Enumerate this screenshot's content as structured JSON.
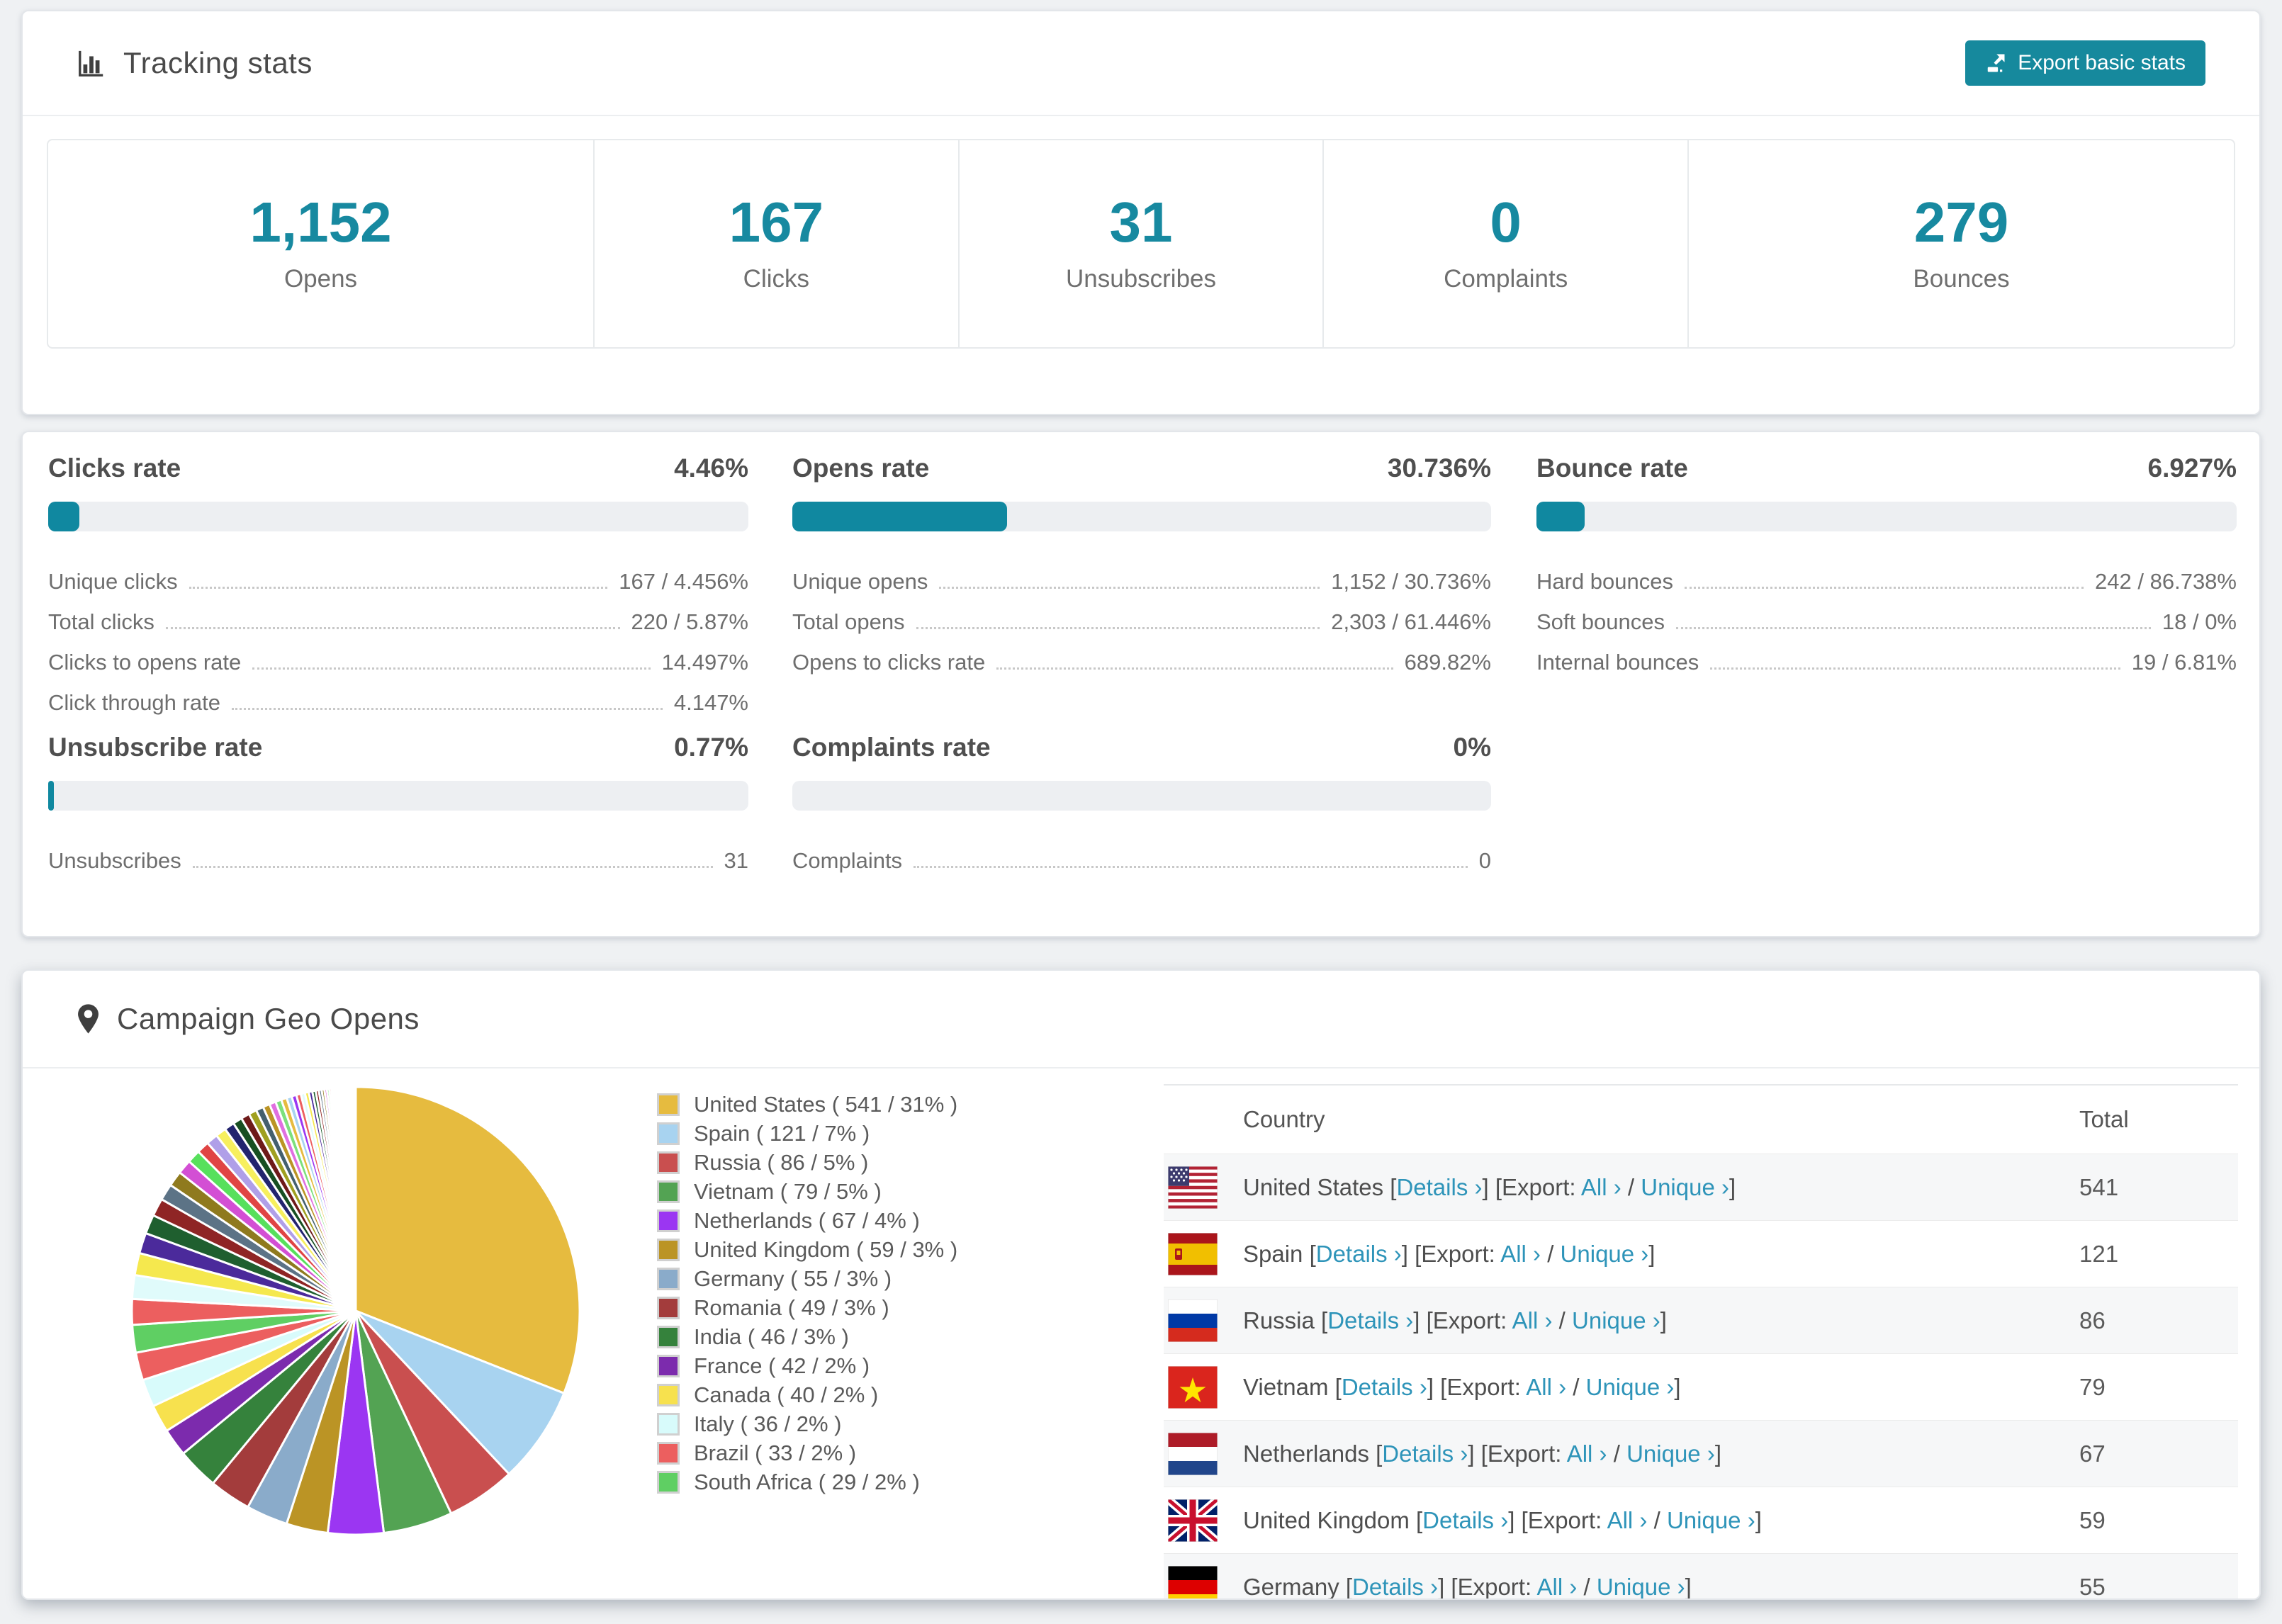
{
  "colors": {
    "accent_teal": "#16899d",
    "link_teal": "#2e94b9",
    "bar_track": "#edeff2",
    "bar_fill": "#1088a0"
  },
  "tracking_stats": {
    "title": "Tracking stats",
    "export_button": "Export basic stats",
    "summary": [
      {
        "value": "1,152",
        "label": "Opens"
      },
      {
        "value": "167",
        "label": "Clicks"
      },
      {
        "value": "31",
        "label": "Unsubscribes"
      },
      {
        "value": "0",
        "label": "Complaints"
      },
      {
        "value": "279",
        "label": "Bounces"
      }
    ]
  },
  "rates": [
    {
      "title": "Clicks rate",
      "value": "4.46%",
      "pct": 4.46,
      "rows": [
        {
          "label": "Unique clicks",
          "value": "167 / 4.456%"
        },
        {
          "label": "Total clicks",
          "value": "220 / 5.87%"
        },
        {
          "label": "Clicks to opens rate",
          "value": "14.497%"
        },
        {
          "label": "Click through rate",
          "value": "4.147%"
        }
      ]
    },
    {
      "title": "Opens rate",
      "value": "30.736%",
      "pct": 30.736,
      "rows": [
        {
          "label": "Unique opens",
          "value": "1,152 / 30.736%"
        },
        {
          "label": "Total opens",
          "value": "2,303 / 61.446%"
        },
        {
          "label": "Opens to clicks rate",
          "value": "689.82%"
        }
      ]
    },
    {
      "title": "Bounce rate",
      "value": "6.927%",
      "pct": 6.927,
      "rows": [
        {
          "label": "Hard bounces",
          "value": "242 / 86.738%"
        },
        {
          "label": "Soft bounces",
          "value": "18 / 0%"
        },
        {
          "label": "Internal bounces",
          "value": "19 / 6.81%"
        }
      ]
    },
    {
      "title": "Unsubscribe rate",
      "value": "0.77%",
      "pct": 0.77,
      "rows": [
        {
          "label": "Unsubscribes",
          "value": "31"
        }
      ]
    },
    {
      "title": "Complaints rate",
      "value": "0%",
      "pct": 0,
      "rows": [
        {
          "label": "Complaints",
          "value": "0"
        }
      ]
    }
  ],
  "geo": {
    "title": "Campaign Geo Opens",
    "table": {
      "columns": [
        "Country",
        "Total"
      ],
      "link_labels": {
        "details": "Details ›",
        "export_label": "Export:",
        "all": "All ›",
        "unique": "Unique ›"
      },
      "punctuation": {
        "open": "[",
        "close": "]",
        "slash": "/"
      },
      "rows": [
        {
          "country": "United States",
          "flag": "us",
          "total": "541"
        },
        {
          "country": "Spain",
          "flag": "es",
          "total": "121"
        },
        {
          "country": "Russia",
          "flag": "ru",
          "total": "86"
        },
        {
          "country": "Vietnam",
          "flag": "vn",
          "total": "79"
        },
        {
          "country": "Netherlands",
          "flag": "nl",
          "total": "67"
        },
        {
          "country": "United Kingdom",
          "flag": "gb",
          "total": "59"
        },
        {
          "country": "Germany",
          "flag": "de",
          "total": "55"
        }
      ]
    }
  },
  "chart_data": {
    "type": "pie",
    "title": "Campaign Geo Opens",
    "legend_position": "right",
    "start_angle_deg": -90,
    "direction": "clockwise",
    "series": [
      {
        "label": "United States",
        "value": 541,
        "pct": 31,
        "color": "#e6bb3f"
      },
      {
        "label": "Spain",
        "value": 121,
        "pct": 7,
        "color": "#a8d3f0"
      },
      {
        "label": "Russia",
        "value": 86,
        "pct": 5,
        "color": "#c94f4f"
      },
      {
        "label": "Vietnam",
        "value": 79,
        "pct": 5,
        "color": "#53a353"
      },
      {
        "label": "Netherlands",
        "value": 67,
        "pct": 4,
        "color": "#9b36f2"
      },
      {
        "label": "United Kingdom",
        "value": 59,
        "pct": 3,
        "color": "#bb9425"
      },
      {
        "label": "Germany",
        "value": 55,
        "pct": 3,
        "color": "#8aabca"
      },
      {
        "label": "Romania",
        "value": 49,
        "pct": 3,
        "color": "#a33c3c"
      },
      {
        "label": "India",
        "value": 46,
        "pct": 3,
        "color": "#35823c"
      },
      {
        "label": "France",
        "value": 42,
        "pct": 2,
        "color": "#7c2bad"
      },
      {
        "label": "Canada",
        "value": 40,
        "pct": 2,
        "color": "#f7e14e"
      },
      {
        "label": "Italy",
        "value": 36,
        "pct": 2,
        "color": "#d8fbfb"
      },
      {
        "label": "Brazil",
        "value": 33,
        "pct": 2,
        "color": "#ec5f5f"
      },
      {
        "label": "South Africa",
        "value": 29,
        "pct": 2,
        "color": "#5fcf63"
      }
    ],
    "others": {
      "total_pct": 26,
      "count": 60,
      "decay": 0.93,
      "palette": [
        "#ec5f5f",
        "#e0fbfb",
        "#f5e84e",
        "#4b2a9b",
        "#1f5f2f",
        "#8f2525",
        "#5c7386",
        "#8f7a1e",
        "#d34fd4",
        "#57e05c",
        "#e04444",
        "#b09fe8",
        "#f7ef5e",
        "#23246e",
        "#174f22",
        "#6e1a1a",
        "#a0a020",
        "#44606e",
        "#bb9425",
        "#e06fe0",
        "#7ce07c",
        "#e6bb3f",
        "#a8d3f0",
        "#9b36f2"
      ]
    }
  }
}
